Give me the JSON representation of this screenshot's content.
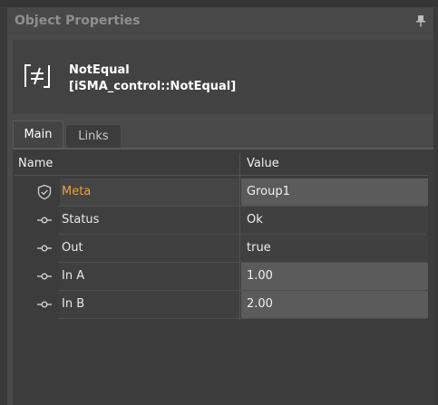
{
  "panel": {
    "title": "Object Properties"
  },
  "object": {
    "name": "NotEqual",
    "type": "[iSMA_control::NotEqual]"
  },
  "tabs": [
    {
      "label": "Main"
    },
    {
      "label": "Links"
    }
  ],
  "grid": {
    "headers": {
      "name": "Name",
      "value": "Value"
    },
    "rows": [
      {
        "name": "Meta",
        "value": "Group1",
        "icon": "shield-check-icon",
        "name_color": "#e6a23c"
      },
      {
        "name": "Status",
        "value": "Ok",
        "icon": "slot-link-icon"
      },
      {
        "name": "Out",
        "value": "true",
        "icon": "slot-link-icon"
      },
      {
        "name": "In A",
        "value": "1.00",
        "icon": "slot-link-icon"
      },
      {
        "name": "In B",
        "value": "2.00",
        "icon": "slot-link-icon"
      }
    ]
  },
  "colors": {
    "accent": "#e6a23c",
    "panel_bg": "#4a4a4a",
    "content_bg": "#3c3c3c"
  }
}
